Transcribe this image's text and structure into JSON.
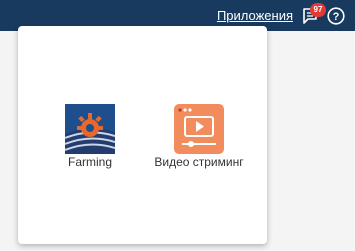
{
  "topbar": {
    "apps_label": "Приложения",
    "notifications_count": "97",
    "message_icon": "message-icon",
    "help_icon": "help-icon",
    "colors": {
      "background": "#173a5e",
      "badge": "#e53935"
    }
  },
  "apps": [
    {
      "label": "Farming",
      "icon": "farming-gear-icon",
      "color": "#1f4e8c"
    },
    {
      "label": "Видео стриминг",
      "icon": "video-player-icon",
      "color": "#f28c5c"
    }
  ]
}
